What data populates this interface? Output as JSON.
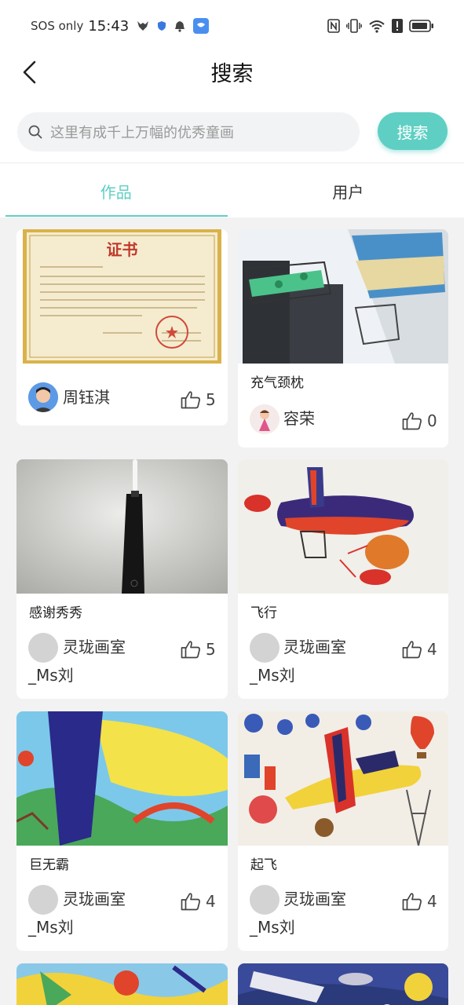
{
  "status_bar": {
    "sos": "SOS only",
    "time": "15:43"
  },
  "header": {
    "title": "搜索"
  },
  "search": {
    "placeholder": "这里有成千上万幅的优秀童画",
    "button_label": "搜索"
  },
  "tabs": [
    {
      "label": "作品",
      "active": true
    },
    {
      "label": "用户",
      "active": false
    }
  ],
  "colors": {
    "accent": "#5fcfc4",
    "grid_background": "#f2f2f2"
  },
  "cards": [
    {
      "title": "",
      "thumb_text": "证书",
      "author": "周钰淇",
      "likes": "5",
      "avatar": "child-photo"
    },
    {
      "title": "充气颈枕",
      "author": "容荣",
      "likes": "0",
      "avatar": "drawing-avatar"
    },
    {
      "title": "感谢秀秀",
      "author": "灵珑画室",
      "author_suffix": "_Ms刘",
      "likes": "5",
      "avatar": "default-gray"
    },
    {
      "title": "飞行",
      "author": "灵珑画室",
      "author_suffix": "_Ms刘",
      "likes": "4",
      "avatar": "default-gray"
    },
    {
      "title": "巨无霸",
      "author": "灵珑画室",
      "author_suffix": "_Ms刘",
      "likes": "4",
      "avatar": "default-gray"
    },
    {
      "title": "起飞",
      "author": "灵珑画室",
      "author_suffix": "_Ms刘",
      "likes": "4",
      "avatar": "default-gray"
    }
  ]
}
